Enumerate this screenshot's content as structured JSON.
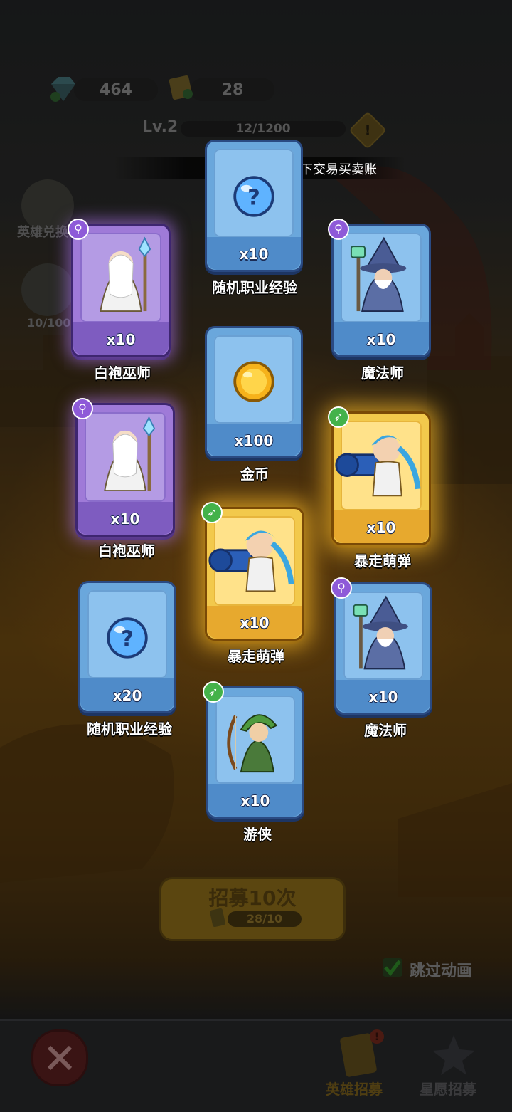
{
  "hud": {
    "gems": "464",
    "tickets": "28",
    "level": "Lv.2",
    "xp": "12/1200",
    "notice": "切勿私下交易买卖账"
  },
  "side": {
    "hero_exchange": "英雄兑换",
    "star_progress": "10/100"
  },
  "cards": [
    {
      "name": "随机职业经验",
      "qty": "x10",
      "rarity": "blue",
      "art": "question-orb"
    },
    {
      "name": "白袍巫师",
      "qty": "x10",
      "rarity": "purple",
      "art": "white-wizard",
      "class": "mage"
    },
    {
      "name": "魔法师",
      "qty": "x10",
      "rarity": "blue",
      "art": "blue-wizard",
      "class": "mage"
    },
    {
      "name": "金币",
      "qty": "x100",
      "rarity": "blue",
      "art": "gold-coin"
    },
    {
      "name": "白袍巫师",
      "qty": "x10",
      "rarity": "purple",
      "art": "white-wizard",
      "class": "mage"
    },
    {
      "name": "暴走萌弹",
      "qty": "x10",
      "rarity": "gold",
      "art": "cannon-hero",
      "class": "archer"
    },
    {
      "name": "暴走萌弹",
      "qty": "x10",
      "rarity": "gold",
      "art": "cannon-hero",
      "class": "archer"
    },
    {
      "name": "随机职业经验",
      "qty": "x20",
      "rarity": "blue",
      "art": "question-orb"
    },
    {
      "name": "魔法师",
      "qty": "x10",
      "rarity": "blue",
      "art": "blue-wizard",
      "class": "mage"
    },
    {
      "name": "游侠",
      "qty": "x10",
      "rarity": "blue",
      "art": "ranger",
      "class": "archer"
    }
  ],
  "recruit": {
    "label": "招募10次",
    "count": "28/10"
  },
  "skip_animation": "跳过动画",
  "tabs": {
    "hero_recruit": "英雄招募",
    "star_recruit": "星愿招募"
  },
  "colors": {
    "blue_card": "#6aa7dc",
    "purple_card": "#9f7ad8",
    "gold_card": "#f2c94c"
  }
}
